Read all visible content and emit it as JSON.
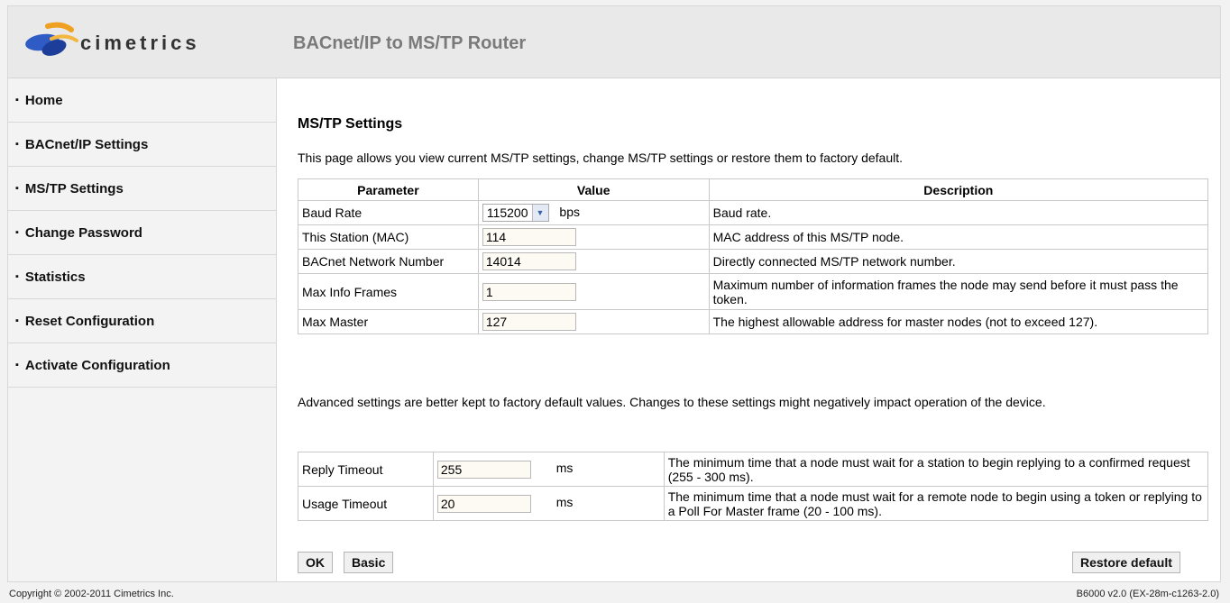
{
  "header": {
    "logo_text": "cimetrics",
    "title": "BACnet/IP to MS/TP Router"
  },
  "sidebar": {
    "items": [
      {
        "label": "Home"
      },
      {
        "label": "BACnet/IP Settings"
      },
      {
        "label": "MS/TP Settings"
      },
      {
        "label": "Change Password"
      },
      {
        "label": "Statistics"
      },
      {
        "label": "Reset Configuration"
      },
      {
        "label": "Activate Configuration"
      }
    ]
  },
  "main": {
    "title": "MS/TP Settings",
    "intro": "This page allows you view current MS/TP settings, change MS/TP settings or restore them to factory default.",
    "table": {
      "headers": [
        "Parameter",
        "Value",
        "Description"
      ],
      "baud_rate": {
        "label": "Baud Rate",
        "value": "115200",
        "unit": "bps",
        "description": "Baud rate."
      },
      "mac": {
        "label": "This Station (MAC)",
        "value": "114",
        "description": "MAC address of this MS/TP node."
      },
      "network": {
        "label": "BACnet Network Number",
        "value": "14014",
        "description": "Directly connected MS/TP network number."
      },
      "max_info": {
        "label": "Max Info Frames",
        "value": "1",
        "description": "Maximum number of information frames the node may send before it must pass the token."
      },
      "max_master": {
        "label": "Max Master",
        "value": "127",
        "description": "The highest allowable address for master nodes (not to exceed 127)."
      }
    },
    "advanced_note": "Advanced settings are better kept to factory default values. Changes to these settings might negatively impact operation of the device.",
    "advanced": {
      "reply": {
        "label": "Reply Timeout",
        "value": "255",
        "unit": "ms",
        "description": "The minimum time that a node must wait for a station to begin replying to a confirmed request (255 - 300 ms)."
      },
      "usage": {
        "label": "Usage Timeout",
        "value": "20",
        "unit": "ms",
        "description": "The minimum time that a node must wait for a remote node to begin using a token or replying to a Poll For Master frame (20 - 100 ms)."
      }
    },
    "buttons": {
      "ok": "OK",
      "basic": "Basic",
      "restore": "Restore default"
    }
  },
  "footer": {
    "copyright": "Copyright © 2002-2011 Cimetrics Inc.",
    "version": "B6000 v2.0 (EX-28m-c1263-2.0)"
  },
  "colors": {
    "header_bg": "#e9e9e9",
    "sidebar_bg": "#f3f3f3",
    "input_bg": "#fdfaf3",
    "logo_orange": "#f0a020",
    "logo_blue": "#2f5cc4"
  }
}
